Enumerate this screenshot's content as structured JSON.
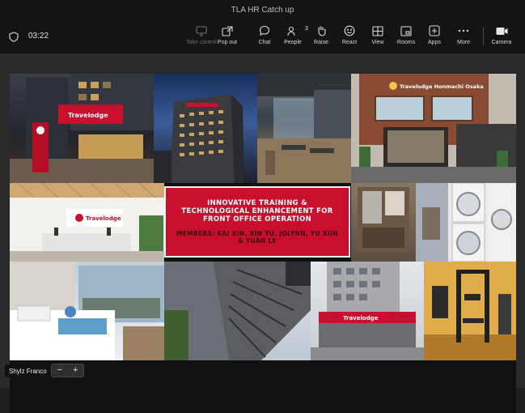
{
  "window": {
    "title": "TLA HR Catch up"
  },
  "meeting": {
    "elapsed": "03:22"
  },
  "toolbar": {
    "items": [
      {
        "label": "Take control",
        "icon": "take-control-icon",
        "enabled": false
      },
      {
        "label": "Pop out",
        "icon": "pop-out-icon",
        "enabled": true
      },
      {
        "label": "Chat",
        "icon": "chat-icon",
        "enabled": true
      },
      {
        "label": "People",
        "icon": "people-icon",
        "enabled": true,
        "badge": "3"
      },
      {
        "label": "Raise",
        "icon": "raise-hand-icon",
        "enabled": true
      },
      {
        "label": "React",
        "icon": "react-icon",
        "enabled": true
      },
      {
        "label": "View",
        "icon": "view-icon",
        "enabled": true
      },
      {
        "label": "Rooms",
        "icon": "rooms-icon",
        "enabled": true
      },
      {
        "label": "Apps",
        "icon": "apps-icon",
        "enabled": true
      },
      {
        "label": "More",
        "icon": "more-icon",
        "enabled": true
      },
      {
        "label": "Camera",
        "icon": "camera-icon",
        "enabled": true
      }
    ]
  },
  "slide": {
    "title": "INNOVATIVE TRAINING & TECHNOLOGICAL ENHANCEMENT FOR FRONT OFFICE OPERATION",
    "members": "MEMBERS: KAI XIN, XIN YU, JOLYNN, YU XUN & YUAN LE",
    "signs": {
      "hotel_sign_1": "Travelodge",
      "hotel_sign_2": "Travelodge Honmachi Osaka",
      "lobby_sign": "Travelodge",
      "street_sign": "Travelodge"
    },
    "accent_color": "#c8102e"
  },
  "presenter": {
    "name": "Shylz Franco"
  },
  "zoom_controls": {
    "minus": "−",
    "plus": "+"
  }
}
